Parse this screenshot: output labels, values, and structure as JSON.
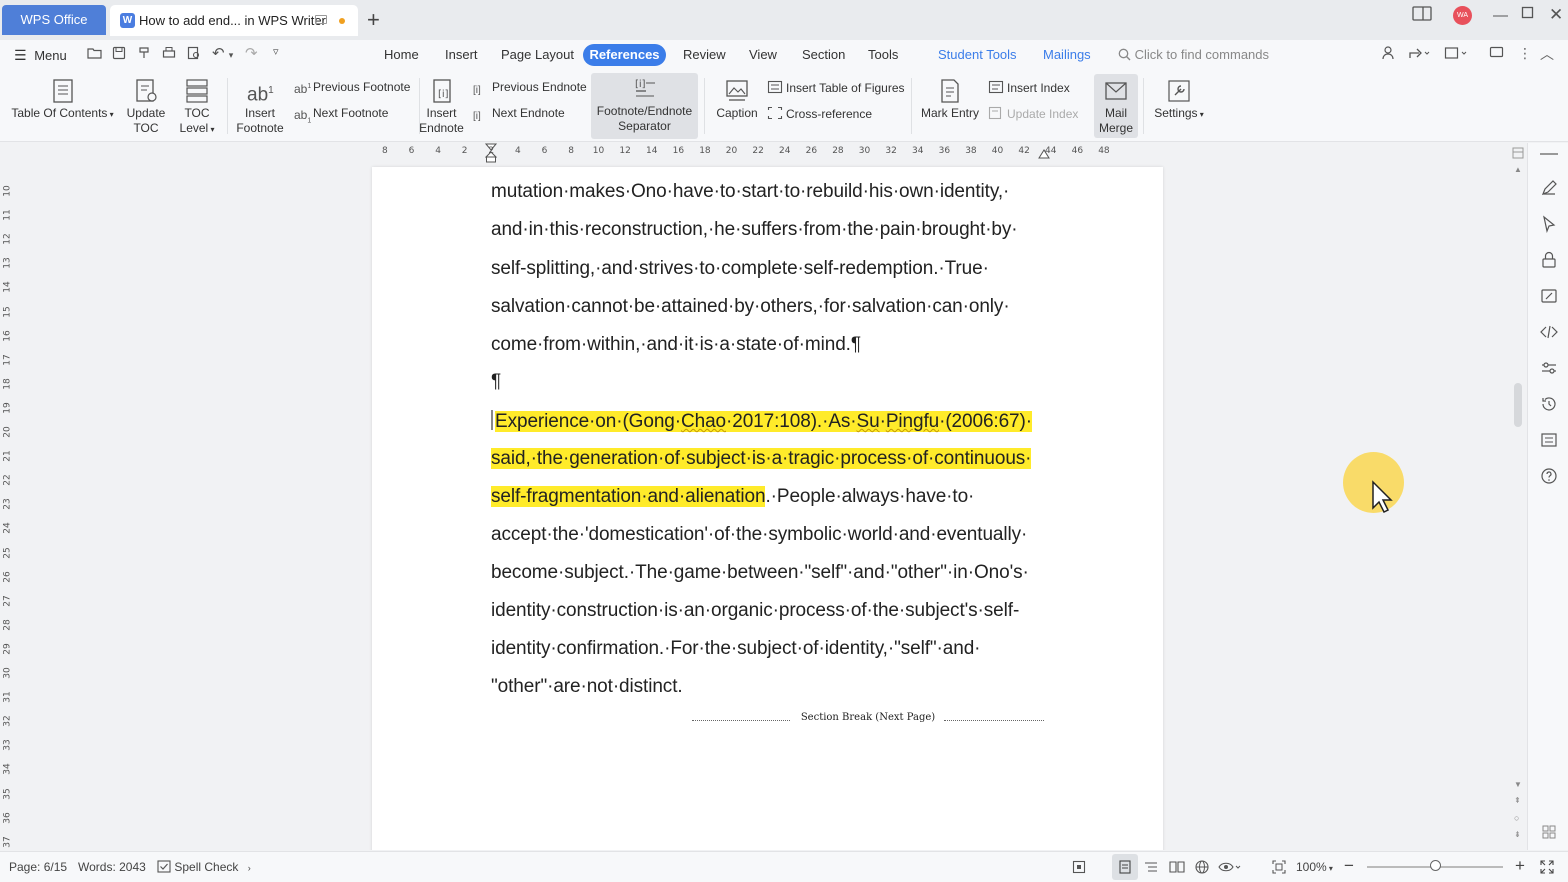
{
  "titlebar": {
    "app_tab": "WPS Office",
    "doc_tab": "How to add end... in WPS Writer",
    "avatar_initials": "WA"
  },
  "menubar": {
    "menu_label": "Menu",
    "tabs": [
      "Home",
      "Insert",
      "Page Layout",
      "References",
      "Review",
      "View",
      "Section",
      "Tools"
    ],
    "active_tab": "References",
    "extra_tabs": [
      "Student Tools",
      "Mailings"
    ],
    "search_placeholder": "Click to find commands"
  },
  "ribbon": {
    "table_of_contents": "Table Of Contents",
    "update_toc": [
      "Update",
      "TOC"
    ],
    "toc_level": [
      "TOC",
      "Level"
    ],
    "insert_footnote": [
      "Insert",
      "Footnote"
    ],
    "previous_footnote": "Previous Footnote",
    "next_footnote": "Next Footnote",
    "insert_endnote": [
      "Insert",
      "Endnote"
    ],
    "previous_endnote": "Previous Endnote",
    "next_endnote": "Next Endnote",
    "separator": [
      "Footnote/Endnote",
      "Separator"
    ],
    "caption": "Caption",
    "insert_table_of_figures": "Insert Table of Figures",
    "cross_reference": "Cross-reference",
    "mark_entry": "Mark Entry",
    "insert_index": "Insert Index",
    "update_index": "Update Index",
    "mail_merge": [
      "Mail",
      "Merge"
    ],
    "settings": "Settings"
  },
  "ruler": {
    "h_ticks": [
      "8",
      "6",
      "4",
      "2",
      "2",
      "4",
      "6",
      "8",
      "10",
      "12",
      "14",
      "16",
      "18",
      "20",
      "22",
      "24",
      "26",
      "28",
      "30",
      "32",
      "34",
      "36",
      "38",
      "40",
      "42",
      "44",
      "46",
      "48"
    ],
    "v_ticks": [
      "10",
      "11",
      "12",
      "13",
      "14",
      "15",
      "16",
      "17",
      "18",
      "19",
      "20",
      "21",
      "22",
      "23",
      "24",
      "25",
      "26",
      "27",
      "28",
      "29",
      "30",
      "31",
      "32",
      "33",
      "34",
      "35",
      "36",
      "37"
    ]
  },
  "document": {
    "lines": [
      "mutation·makes·Ono·have·to·start·to·rebuild·his·own·identity,·",
      "and·in·this·reconstruction,·he·suffers·from·the·pain·brought·by·",
      "self-splitting,·and·strives·to·complete·self-redemption.·True·",
      "salvation·cannot·be·attained·by·others,·for·salvation·can·only·",
      "come·from·within,·and·it·is·a·state·of·mind.¶",
      "¶"
    ],
    "hl_line1_a": "Experience·on·(Gong·",
    "hl_line1_b": "Chao",
    "hl_line1_c": "·2017:108).·As·",
    "hl_line1_d": "Su",
    "hl_line1_e": "·",
    "hl_line1_f": "Pingfu",
    "hl_line1_g": "·(2006:67)·",
    "hl_line2": "said,·the·generation·of·subject·is·a·tragic·process·of·continuous·",
    "hl_line3": "self-fragmentation·and·alienation",
    "line3_rest": ".·People·always·have·to·",
    "rest_lines": [
      "accept·the·'domestication'·of·the·symbolic·world·and·eventually·",
      "become·subject.·The·game·between·\"self\"·and·\"other\"·in·Ono's·",
      "identity·construction·is·an·organic·process·of·the·subject's·self-",
      "identity·confirmation.·For·the·subject·of·identity,·\"self\"·and·"
    ],
    "last_line": "\"other\"·are·not·distinct.",
    "section_break": "Section Break (Next Page)"
  },
  "statusbar": {
    "page": "Page: 6/15",
    "words": "Words: 2043",
    "spell_check": "Spell Check",
    "zoom": "100%"
  },
  "colors": {
    "accent": "#3b7de9",
    "highlight": "#ffeb2a",
    "wps_tab": "#4f7fd8"
  }
}
